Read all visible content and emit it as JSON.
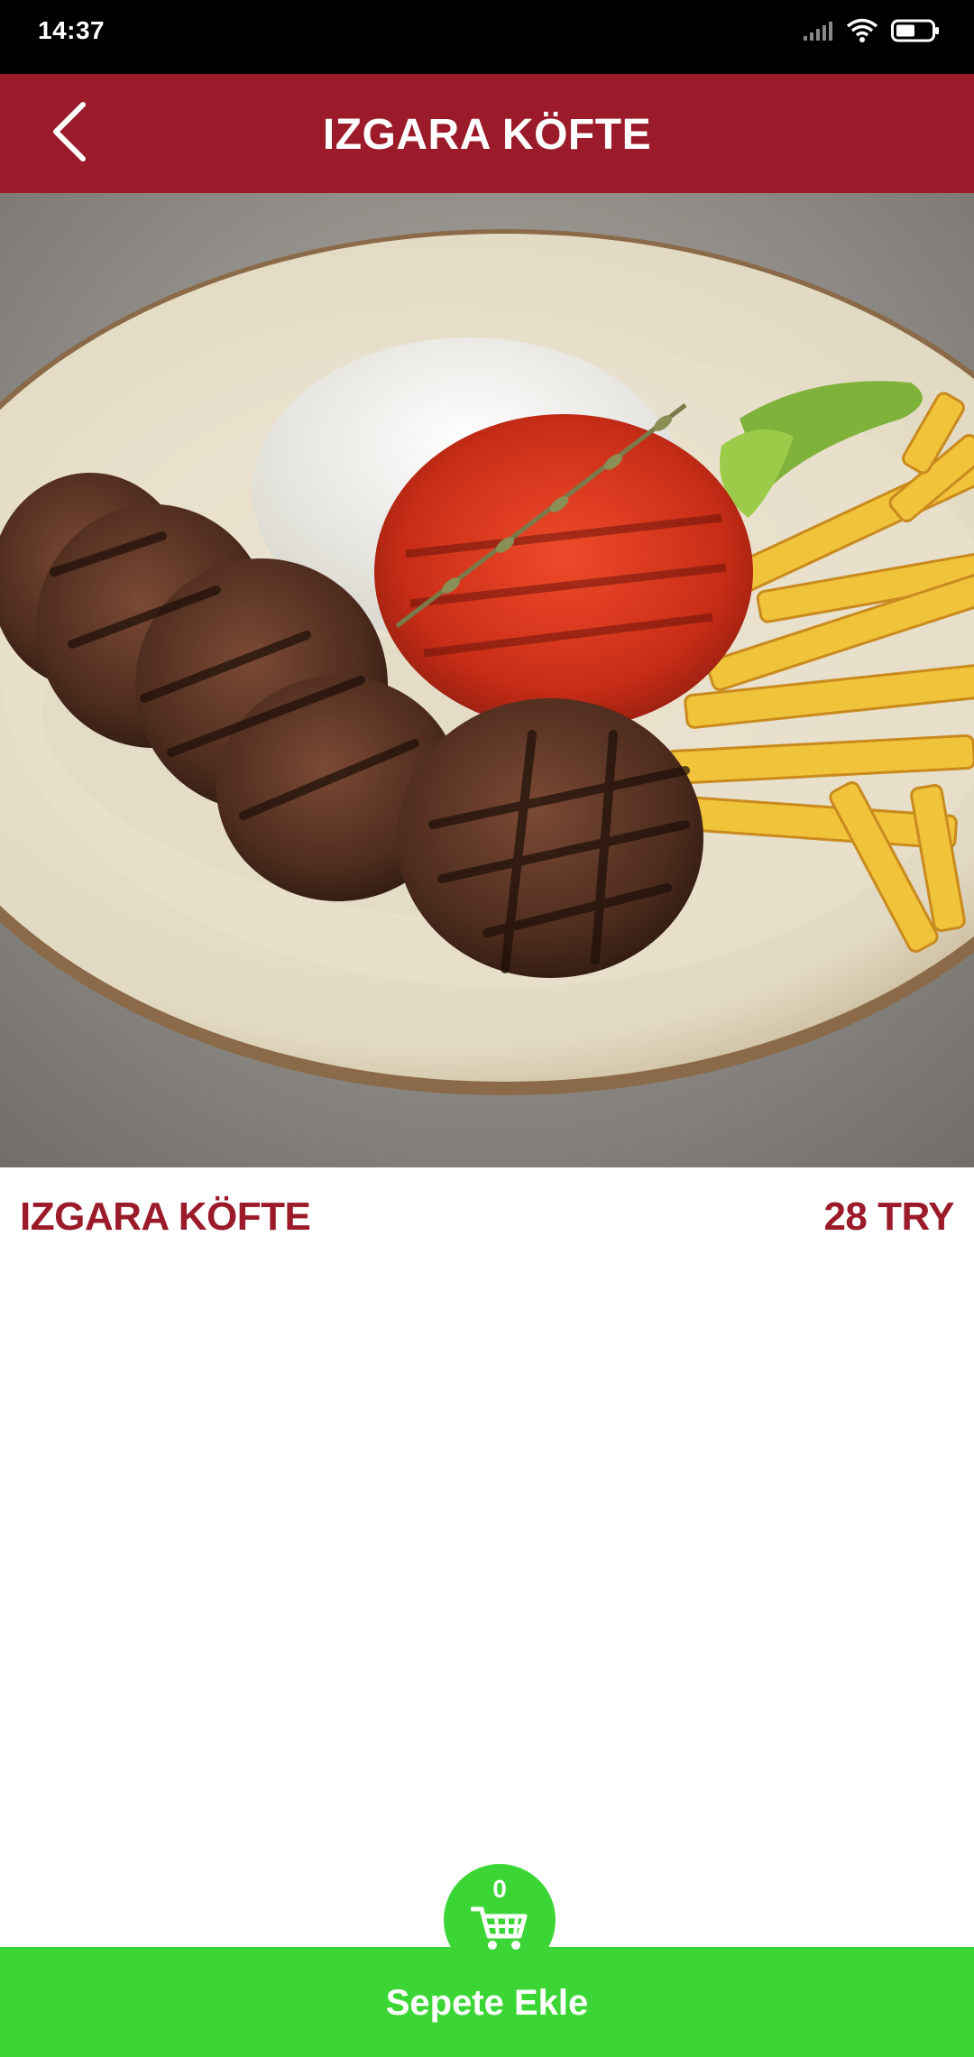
{
  "status_bar": {
    "time": "14:37"
  },
  "header": {
    "title": "IZGARA KÖFTE",
    "back_icon": "chevron-left-icon"
  },
  "product": {
    "image_icon": "food-photo",
    "name": "IZGARA KÖFTE",
    "price": "28 TRY"
  },
  "cart": {
    "count": "0",
    "add_label": "Sepete Ekle",
    "icon": "shopping-cart-icon"
  },
  "colors": {
    "brand_red": "#9b1b2a",
    "cart_green": "#3bd635",
    "status_bar": "#000000"
  }
}
